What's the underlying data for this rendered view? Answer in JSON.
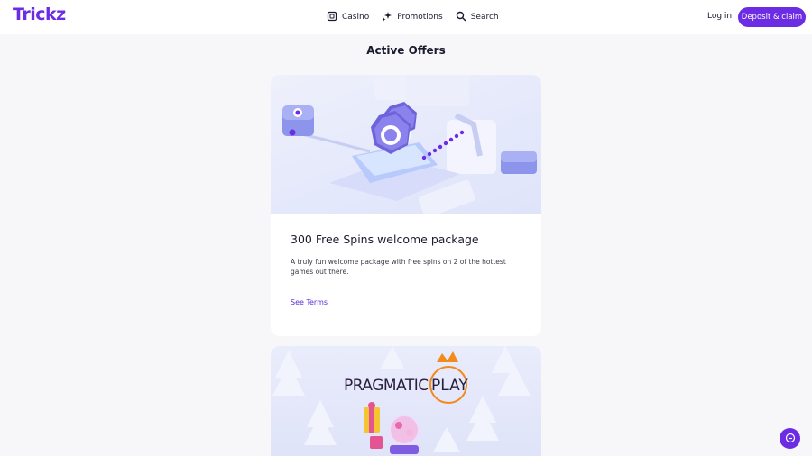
{
  "header": {
    "logo": "Trickz",
    "nav": [
      {
        "label": "Casino",
        "icon": "casino-icon"
      },
      {
        "label": "Promotions",
        "icon": "sparkle-icon"
      },
      {
        "label": "Search",
        "icon": "search-icon"
      }
    ],
    "login_label": "Log in",
    "deposit_label": "Deposit & claim"
  },
  "main": {
    "title": "Active Offers",
    "offers": [
      {
        "title": "300 Free Spins welcome package",
        "description": "A truly fun welcome package with free spins on 2 of the hottest games out there.",
        "terms_label": "See Terms"
      },
      {
        "brand_pre": "PRAGMATIC",
        "brand_post": "PLAY"
      }
    ]
  },
  "colors": {
    "accent": "#6b2ce3",
    "background": "#f7f7f9",
    "card": "#ffffff",
    "link": "#5a2bd6",
    "brand_ring": "#f28a1c"
  },
  "chat": {
    "icon": "chat-icon"
  }
}
